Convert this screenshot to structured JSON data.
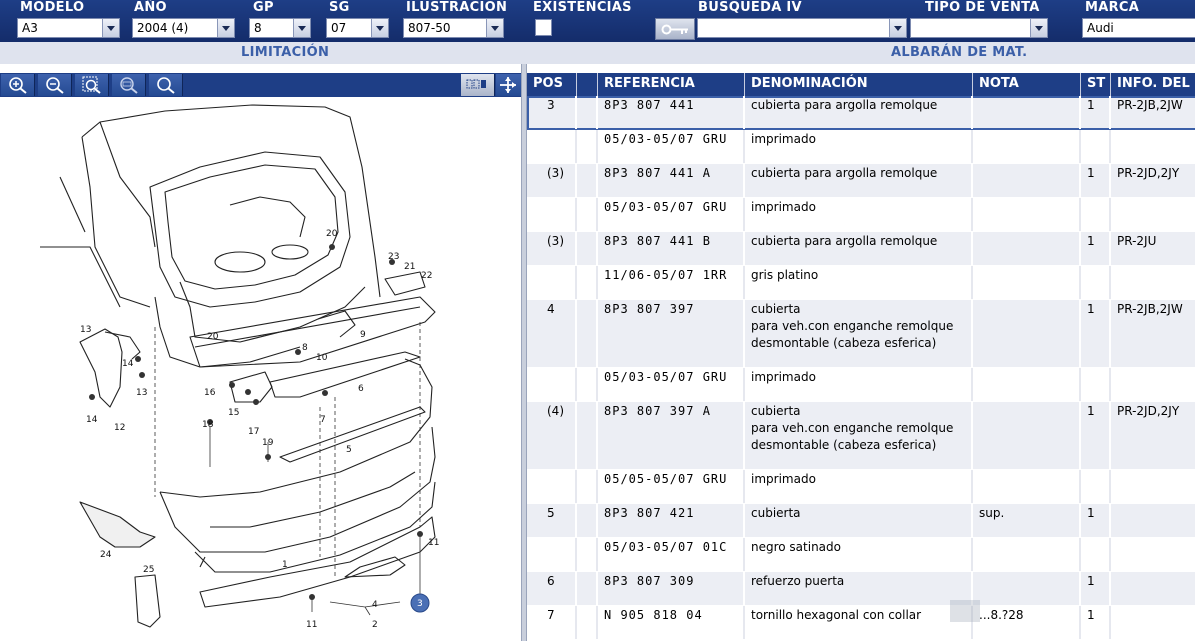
{
  "filters": {
    "modelo": {
      "label": "MODELO",
      "value": "A3"
    },
    "anio": {
      "label": "AÑO",
      "value": "2004 (4)"
    },
    "gp": {
      "label": "GP",
      "value": "8"
    },
    "sg": {
      "label": "SG",
      "value": "07"
    },
    "ilustracion": {
      "label": "ILUSTRACIÓN",
      "value": "807-50"
    },
    "existencias": {
      "label": "EXISTENCIAS",
      "checked": false
    },
    "busqueda": {
      "label": "BÚSQUEDA IV",
      "value": ""
    },
    "tipo_venta": {
      "label": "TIPO DE VENTA",
      "value": ""
    },
    "marca": {
      "label": "MARCA",
      "value": "Audi"
    }
  },
  "subheader": {
    "left": "LIMITACIÓN",
    "right": "ALBARÁN DE MAT."
  },
  "image_tools": [
    "zoom-in-icon",
    "zoom-out-icon",
    "zoom-region-icon",
    "zoom-100-icon",
    "search-icon"
  ],
  "diagram": {
    "labels": [
      "1",
      "2",
      "3",
      "4",
      "5",
      "6",
      "7",
      "8",
      "9",
      "10",
      "11",
      "11",
      "12",
      "13",
      "13",
      "14",
      "14",
      "15",
      "16",
      "17",
      "18",
      "19",
      "20",
      "20",
      "21",
      "22",
      "23",
      "24",
      "25"
    ]
  },
  "table": {
    "columns": [
      "POS",
      "",
      "REFERENCIA",
      "DENOMINACIÓN",
      "NOTA",
      "ST",
      "INFO. DEL M"
    ],
    "rows": [
      {
        "pos": "3",
        "ref": "8P3 807 441",
        "den": [
          "cubierta para argolla remolque"
        ],
        "nota": "",
        "st": "1",
        "info": "PR-2JB,2JW",
        "selected": true
      },
      {
        "pos": "",
        "ref": "05/03-05/07 GRU",
        "den": [
          "imprimado"
        ],
        "nota": "",
        "st": "",
        "info": ""
      },
      {
        "pos": "(3)",
        "ref": "8P3 807 441 A",
        "den": [
          "cubierta para argolla remolque"
        ],
        "nota": "",
        "st": "1",
        "info": "PR-2JD,2JY"
      },
      {
        "pos": "",
        "ref": "05/03-05/07 GRU",
        "den": [
          "imprimado"
        ],
        "nota": "",
        "st": "",
        "info": ""
      },
      {
        "pos": "(3)",
        "ref": "8P3 807 441 B",
        "den": [
          "cubierta para argolla remolque"
        ],
        "nota": "",
        "st": "1",
        "info": "PR-2JU"
      },
      {
        "pos": "",
        "ref": "11/06-05/07 1RR",
        "den": [
          "gris platino"
        ],
        "nota": "",
        "st": "",
        "info": ""
      },
      {
        "pos": "4",
        "ref": "8P3 807 397",
        "den": [
          "cubierta",
          "para veh.con enganche remolque",
          "desmontable (cabeza esferica)"
        ],
        "nota": "",
        "st": "1",
        "info": "PR-2JB,2JW"
      },
      {
        "pos": "",
        "ref": "05/03-05/07 GRU",
        "den": [
          "imprimado"
        ],
        "nota": "",
        "st": "",
        "info": ""
      },
      {
        "pos": "(4)",
        "ref": "8P3 807 397 A",
        "den": [
          "cubierta",
          "para veh.con enganche remolque",
          "desmontable (cabeza esferica)"
        ],
        "nota": "",
        "st": "1",
        "info": "PR-2JD,2JY"
      },
      {
        "pos": "",
        "ref": "05/05-05/07 GRU",
        "den": [
          "imprimado"
        ],
        "nota": "",
        "st": "",
        "info": ""
      },
      {
        "pos": "5",
        "ref": "8P3 807 421",
        "den": [
          "cubierta"
        ],
        "nota": "sup.",
        "st": "1",
        "info": ""
      },
      {
        "pos": "",
        "ref": "05/03-05/07 01C",
        "den": [
          "negro satinado"
        ],
        "nota": "",
        "st": "",
        "info": ""
      },
      {
        "pos": "6",
        "ref": "8P3 807 309",
        "den": [
          "refuerzo puerta"
        ],
        "nota": "",
        "st": "1",
        "info": ""
      },
      {
        "pos": "7",
        "ref": "N   905 818 04",
        "den": [
          "tornillo hexagonal con collar"
        ],
        "nota": "...8.?28",
        "st": "1",
        "info": ""
      }
    ]
  },
  "colors": {
    "header_bg": "#1e3e86",
    "row_alt": "#eceef4",
    "accent": "#3b5fa8"
  }
}
